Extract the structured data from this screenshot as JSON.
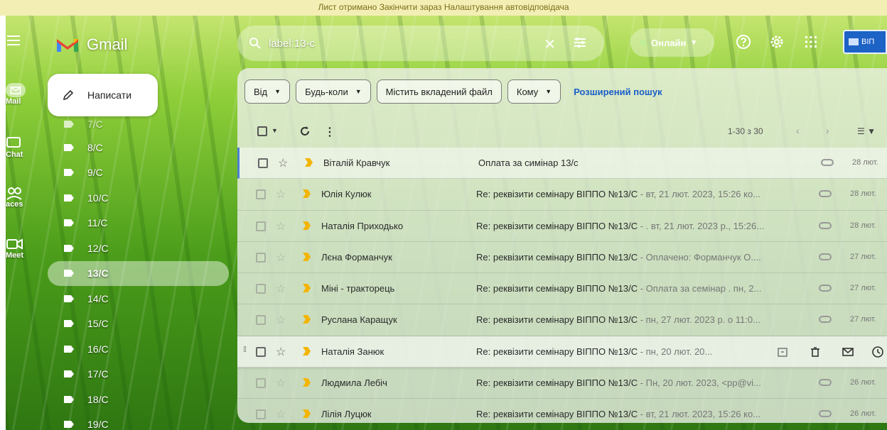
{
  "notice": {
    "text": "Лист отримано  Закінчити зараз  Налаштування автовідповідача"
  },
  "app": {
    "name": "Gmail"
  },
  "rail": [
    {
      "label": "Mail",
      "icon": "mail-icon"
    },
    {
      "label": "Chat",
      "icon": "chat-icon"
    },
    {
      "label": "Spaces",
      "icon": "spaces-icon"
    },
    {
      "label": "Meet",
      "icon": "meet-icon"
    }
  ],
  "rail_visible_text": [
    "Mail",
    "Chat",
    "aces",
    "Meet"
  ],
  "compose": {
    "label": "Написати"
  },
  "labels": [
    {
      "name": "7/C",
      "active": false
    },
    {
      "name": "8/C",
      "active": false
    },
    {
      "name": "9/C",
      "active": false
    },
    {
      "name": "10/C",
      "active": false
    },
    {
      "name": "11/C",
      "active": false
    },
    {
      "name": "12/C",
      "active": false
    },
    {
      "name": "13/C",
      "active": true
    },
    {
      "name": "14/C",
      "active": false
    },
    {
      "name": "15/C",
      "active": false
    },
    {
      "name": "16/C",
      "active": false
    },
    {
      "name": "17/C",
      "active": false
    },
    {
      "name": "18/C",
      "active": false
    },
    {
      "name": "19/C",
      "active": false
    }
  ],
  "search": {
    "query": "label:13-c",
    "clear": "✕"
  },
  "status": {
    "label": "Онлайн"
  },
  "account": {
    "label": "ВІП"
  },
  "filters": {
    "from": "Від",
    "anytime": "Будь-коли",
    "has_attachment": "Містить вкладений файл",
    "to": "Кому",
    "advanced": "Розширений пошук"
  },
  "toolbar": {
    "count": "1-30 з 30",
    "prev": "‹",
    "next": "›"
  },
  "emails": [
    {
      "sender": "Віталій Кравчук",
      "subject": "Оплата за симінар 13/с",
      "snippet": "",
      "date": "28 лют.",
      "unread": true
    },
    {
      "sender": "Юлія Кулюк",
      "subject": "Re: реквізити семінару ВІППО №13/С",
      "snippet": " - вт, 21 лют. 2023, 15:26 ко...",
      "date": "28 лют.",
      "unread": false
    },
    {
      "sender": "Наталія Приходько",
      "subject": "Re: реквізити семінару ВІППО №13/С",
      "snippet": " - . вт, 21 лют. 2023 р., 15:26...",
      "date": "28 лют.",
      "unread": false
    },
    {
      "sender": "Лєна Форманчук",
      "subject": "Re: реквізити семінару ВІППО №13/С",
      "snippet": " - Оплачено: Форманчук О....",
      "date": "27 лют.",
      "unread": false
    },
    {
      "sender": "Міні - тракторець",
      "subject": "Re: реквізити семінару ВІППО №13/С",
      "snippet": " - Оплата за семінар . пн, 2...",
      "date": "27 лют.",
      "unread": false
    },
    {
      "sender": "Руслана Каращук",
      "subject": "Re: реквізити семінару ВІППО №13/С",
      "snippet": " - пн, 27 лют. 2023 р. о 11:0...",
      "date": "27 лют.",
      "unread": false
    },
    {
      "sender": "Наталія Занюк",
      "subject": "Re: реквізити семінару ВІППО №13/С",
      "snippet": " - пн, 20 лют. 20...",
      "date": "",
      "unread": false,
      "hovered": true
    },
    {
      "sender": "Людмила Лебіч",
      "subject": "Re: реквізити семінару ВІППО №13/С",
      "snippet": " - Пн, 20 лют. 2023, <pp@vi...",
      "date": "26 лют.",
      "unread": false
    },
    {
      "sender": "Лілія Луцюк",
      "subject": "Re: реквізити семінару ВІППО №13/С",
      "snippet": " - вт, 21 лют. 2023, 15:26 ко...",
      "date": "26 лют.",
      "unread": false
    }
  ],
  "colors": {
    "accent": "#1a5fc8",
    "important": "#f4b400",
    "grass_dark": "#2f7712"
  }
}
